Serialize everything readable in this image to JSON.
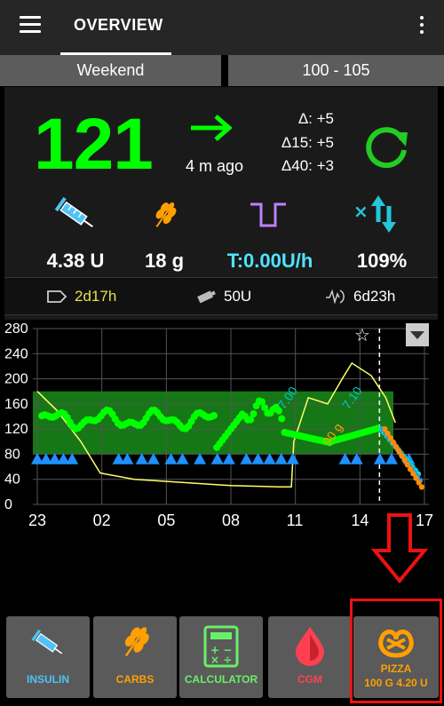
{
  "appbar": {
    "tab_title": "OVERVIEW"
  },
  "profile": {
    "left_label": "Weekend",
    "right_label": "100 - 105"
  },
  "glucose": {
    "value": "121",
    "time_ago": "4 m ago",
    "delta": "Δ: +5",
    "delta15": "Δ15: +5",
    "delta40": "Δ40: +3",
    "trend": "flat-arrow-right"
  },
  "stats": {
    "insulin": "4.38 U",
    "carbs": "18 g",
    "temp_basal": "T:0.00U/h",
    "autosens": "109%"
  },
  "status": {
    "cannula_age": "2d17h",
    "reservoir": "50U",
    "sensor_age": "6d23h"
  },
  "chart_data": {
    "type": "line",
    "y_ticks": [
      "280",
      "240",
      "200",
      "160",
      "120",
      "80",
      "40",
      "0"
    ],
    "x_ticks": [
      "23",
      "02",
      "05",
      "08",
      "11",
      "14",
      "17"
    ],
    "ylim": [
      0,
      280
    ],
    "target_range": [
      80,
      180
    ],
    "annotations": [
      "7.00",
      "7.10",
      "90 g"
    ],
    "colors": {
      "bg": "#00ff00",
      "target": "#1a8c1a",
      "basal": "#ffff66",
      "prediction_a": "#1e90ff",
      "prediction_b": "#ff8c00",
      "prediction_c": "#00e5cc",
      "smb": "#1e90ff",
      "iob_label": "#00c8c8"
    },
    "grid": true
  },
  "quick_actions": [
    {
      "label": "INSULIN",
      "color": "#4fc3f7",
      "icon": "syringe-icon"
    },
    {
      "label": "CARBS",
      "color": "#ffa000",
      "icon": "wheat-icon"
    },
    {
      "label": "CALCULATOR",
      "color": "#69f069",
      "icon": "calculator-icon"
    },
    {
      "label": "CGM",
      "color": "#ff4050",
      "icon": "drop-icon"
    },
    {
      "label": "PIZZA",
      "sublabel": "100 G 4.20 U",
      "color": "#ffa000",
      "icon": "pretzel-icon"
    }
  ]
}
